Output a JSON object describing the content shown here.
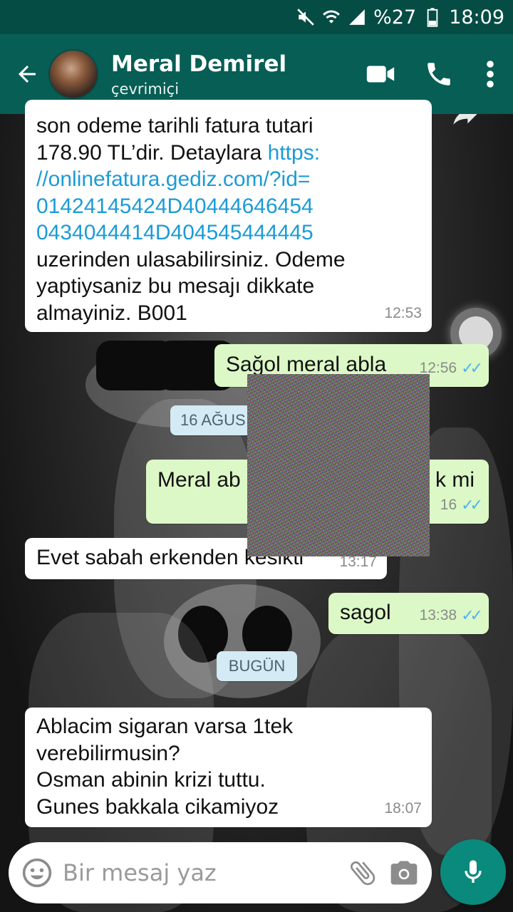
{
  "status_bar": {
    "battery": "%27",
    "time": "18:09"
  },
  "header": {
    "contact_name": "Meral Demirel",
    "status": "çevrimiçi"
  },
  "messages": [
    {
      "lines": [
        "son odeme tarihli fatura tutari",
        "178.90  TL’dir. Detaylara "
      ],
      "link_lines": [
        "https:",
        "//onlinefatura.gediz.com/?id=",
        "01424145424D40444646454",
        "0434044414D404545444445"
      ],
      "tail_lines": [
        "uzerinden ulasabilirsiniz. Odeme",
        "yaptiysaniz bu mesajı dikkate",
        "almayiniz. B001"
      ],
      "time": "12:53"
    },
    {
      "text": "Sağol meral abla",
      "time": "12:56"
    },
    {
      "text": "Meral ab",
      "text_end": "k mi",
      "time": "16"
    },
    {
      "text": "Evet sabah erkenden kesikti",
      "time": "13:17"
    },
    {
      "text": "sagol",
      "time": "13:38"
    },
    {
      "lines": [
        "Ablacim sigaran varsa 1tek",
        "verebilirmusin?",
        "Osman abinin krizi tuttu.",
        "Gunes bakkala cikamiyoz"
      ],
      "time": "18:07"
    }
  ],
  "date_chips": {
    "first": "16 AĞUS",
    "today": "BUGÜN"
  },
  "composer": {
    "placeholder": "Bir mesaj yaz"
  },
  "icons": [
    "mute-icon",
    "wifi-icon",
    "signal-icon",
    "battery-icon",
    "back-arrow-icon",
    "video-call-icon",
    "phone-icon",
    "more-vert-icon",
    "forward-icon",
    "emoji-icon",
    "attach-icon",
    "camera-icon",
    "mic-icon"
  ],
  "colors": {
    "status_bar": "#054d44",
    "app_bar": "#075e54",
    "outgoing_bubble": "#dcf8c6",
    "incoming_bubble": "#ffffff",
    "read_ticks": "#4fb4f0",
    "link": "#1c9bd6",
    "mic_button": "#0a8a7c",
    "date_chip": "#d4eaf4"
  }
}
